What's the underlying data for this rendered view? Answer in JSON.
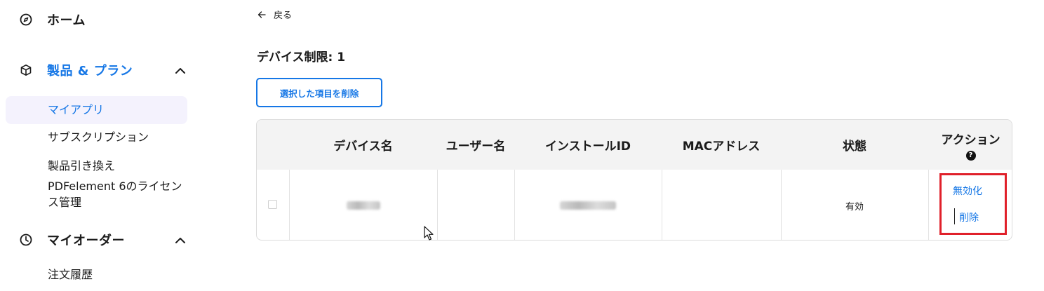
{
  "sidebar": {
    "home": {
      "label": "ホーム",
      "icon": "compass-icon"
    },
    "products": {
      "label": "製品 & プラン",
      "icon": "box-icon",
      "items": [
        {
          "label": "マイアプリ",
          "active": true
        },
        {
          "label": "サブスクリプション"
        },
        {
          "label": "製品引き換え"
        },
        {
          "label_line1": "PDFelement 6のライセン",
          "label_line2": "ス管理"
        }
      ]
    },
    "orders": {
      "label": "マイオーダー",
      "icon": "clock-icon",
      "items": [
        {
          "label": "注文履歴"
        }
      ]
    }
  },
  "main": {
    "back_label": "戻る",
    "device_limit": "デバイス制限: 1",
    "delete_selected_label": "選択した項目を削除",
    "table": {
      "headers": {
        "device_name": "デバイス名",
        "user_name": "ユーザー名",
        "install_id": "インストールID",
        "mac_address": "MACアドレス",
        "status": "状態",
        "actions": "アクション"
      },
      "rows": [
        {
          "status": "有効",
          "action_disable": "無効化",
          "action_delete": "削除"
        }
      ]
    }
  },
  "colors": {
    "accent": "#1677e6",
    "highlight_box": "#e0202a",
    "active_bg": "#f4f2fd",
    "header_bg": "#f3f3f3"
  }
}
